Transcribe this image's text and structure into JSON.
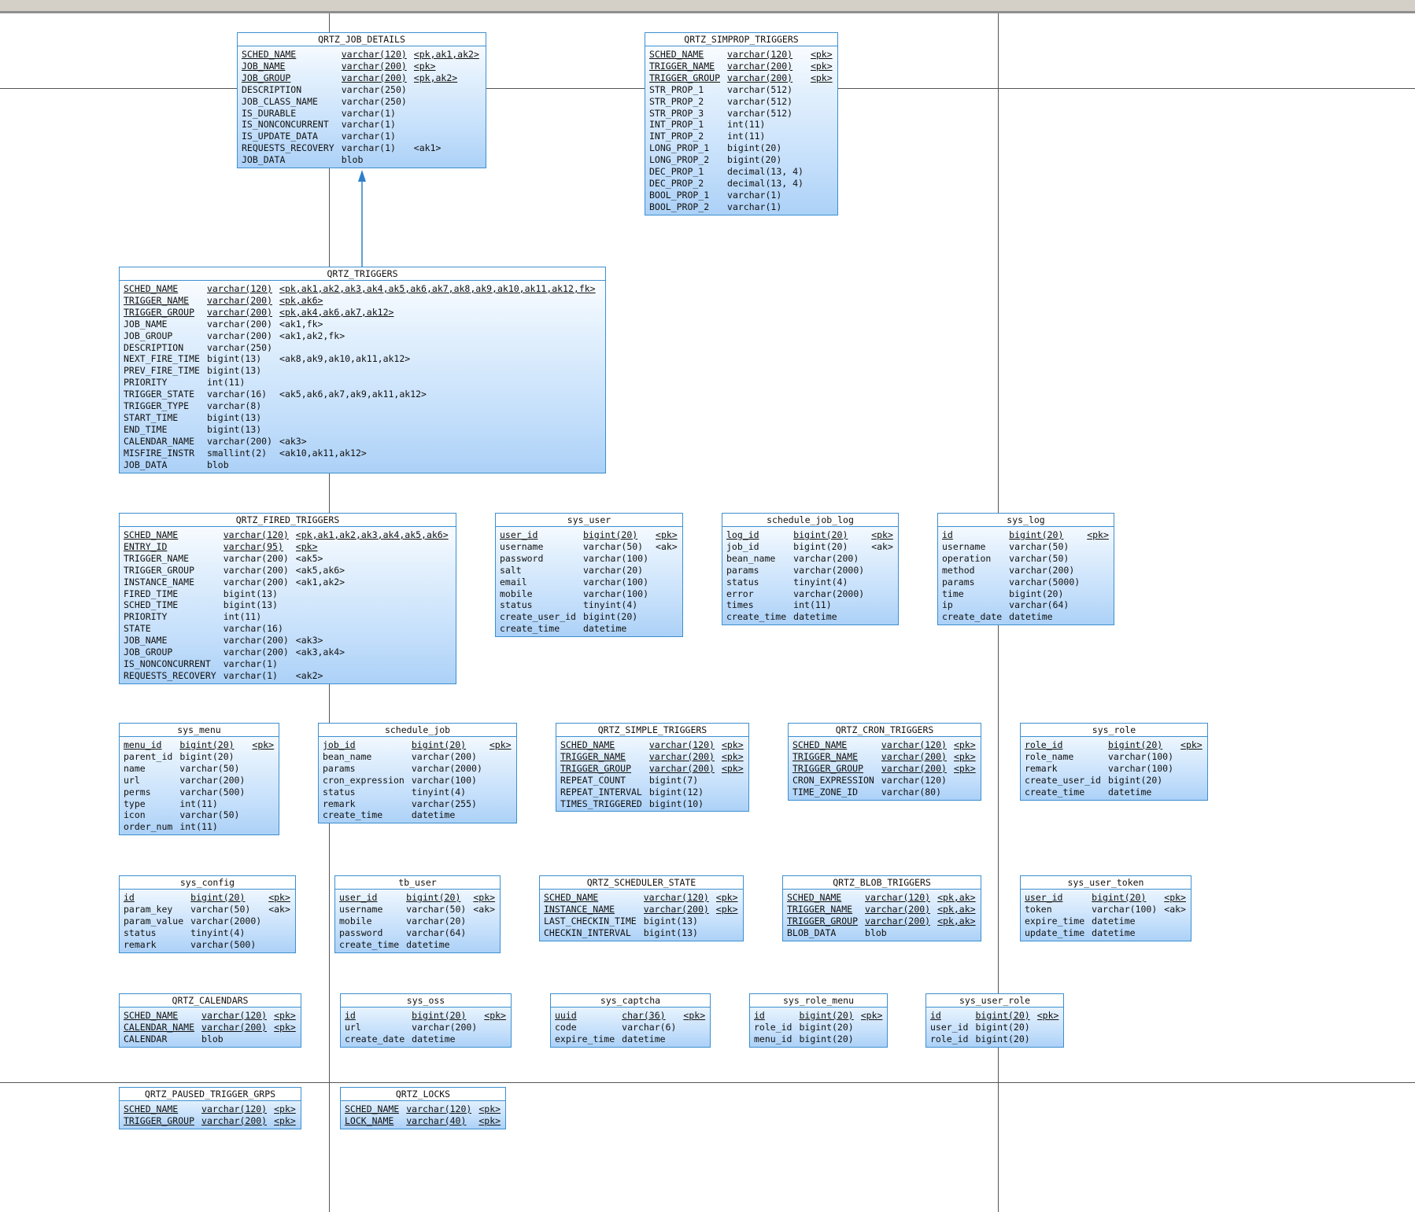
{
  "tables": [
    {
      "name": "QRTZ_JOB_DETAILS",
      "cols": [
        [
          "SCHED_NAME",
          "varchar(120)",
          "<pk,ak1,ak2>",
          1
        ],
        [
          "JOB_NAME",
          "varchar(200)",
          "<pk>",
          1
        ],
        [
          "JOB_GROUP",
          "varchar(200)",
          "<pk,ak2>",
          1
        ],
        [
          "DESCRIPTION",
          "varchar(250)",
          "",
          0
        ],
        [
          "JOB_CLASS_NAME",
          "varchar(250)",
          "",
          0
        ],
        [
          "IS_DURABLE",
          "varchar(1)",
          "",
          0
        ],
        [
          "IS_NONCONCURRENT",
          "varchar(1)",
          "",
          0
        ],
        [
          "IS_UPDATE_DATA",
          "varchar(1)",
          "",
          0
        ],
        [
          "REQUESTS_RECOVERY",
          "varchar(1)",
          "<ak1>",
          0
        ],
        [
          "JOB_DATA",
          "blob",
          "",
          0
        ]
      ]
    },
    {
      "name": "QRTZ_SIMPROP_TRIGGERS",
      "cols": [
        [
          "SCHED_NAME",
          "varchar(120)",
          "<pk>",
          1
        ],
        [
          "TRIGGER_NAME",
          "varchar(200)",
          "<pk>",
          1
        ],
        [
          "TRIGGER_GROUP",
          "varchar(200)",
          "<pk>",
          1
        ],
        [
          "STR_PROP_1",
          "varchar(512)",
          "",
          0
        ],
        [
          "STR_PROP_2",
          "varchar(512)",
          "",
          0
        ],
        [
          "STR_PROP_3",
          "varchar(512)",
          "",
          0
        ],
        [
          "INT_PROP_1",
          "int(11)",
          "",
          0
        ],
        [
          "INT_PROP_2",
          "int(11)",
          "",
          0
        ],
        [
          "LONG_PROP_1",
          "bigint(20)",
          "",
          0
        ],
        [
          "LONG_PROP_2",
          "bigint(20)",
          "",
          0
        ],
        [
          "DEC_PROP_1",
          "decimal(13, 4)",
          "",
          0
        ],
        [
          "DEC_PROP_2",
          "decimal(13, 4)",
          "",
          0
        ],
        [
          "BOOL_PROP_1",
          "varchar(1)",
          "",
          0
        ],
        [
          "BOOL_PROP_2",
          "varchar(1)",
          "",
          0
        ]
      ]
    },
    {
      "name": "QRTZ_TRIGGERS",
      "cols": [
        [
          "SCHED_NAME",
          "varchar(120)",
          "<pk,ak1,ak2,ak3,ak4,ak5,ak6,ak7,ak8,ak9,ak10,ak11,ak12,fk>",
          1
        ],
        [
          "TRIGGER_NAME",
          "varchar(200)",
          "<pk,ak6>",
          1
        ],
        [
          "TRIGGER_GROUP",
          "varchar(200)",
          "<pk,ak4,ak6,ak7,ak12>",
          1
        ],
        [
          "JOB_NAME",
          "varchar(200)",
          "<ak1,fk>",
          0
        ],
        [
          "JOB_GROUP",
          "varchar(200)",
          "<ak1,ak2,fk>",
          0
        ],
        [
          "DESCRIPTION",
          "varchar(250)",
          "",
          0
        ],
        [
          "NEXT_FIRE_TIME",
          "bigint(13)",
          "<ak8,ak9,ak10,ak11,ak12>",
          0
        ],
        [
          "PREV_FIRE_TIME",
          "bigint(13)",
          "",
          0
        ],
        [
          "PRIORITY",
          "int(11)",
          "",
          0
        ],
        [
          "TRIGGER_STATE",
          "varchar(16)",
          "<ak5,ak6,ak7,ak9,ak11,ak12>",
          0
        ],
        [
          "TRIGGER_TYPE",
          "varchar(8)",
          "",
          0
        ],
        [
          "START_TIME",
          "bigint(13)",
          "",
          0
        ],
        [
          "END_TIME",
          "bigint(13)",
          "",
          0
        ],
        [
          "CALENDAR_NAME",
          "varchar(200)",
          "<ak3>",
          0
        ],
        [
          "MISFIRE_INSTR",
          "smallint(2)",
          "<ak10,ak11,ak12>",
          0
        ],
        [
          "JOB_DATA",
          "blob",
          "",
          0
        ]
      ]
    },
    {
      "name": "QRTZ_FIRED_TRIGGERS",
      "cols": [
        [
          "SCHED_NAME",
          "varchar(120)",
          "<pk,ak1,ak2,ak3,ak4,ak5,ak6>",
          1
        ],
        [
          "ENTRY_ID",
          "varchar(95)",
          "<pk>",
          1
        ],
        [
          "TRIGGER_NAME",
          "varchar(200)",
          "<ak5>",
          0
        ],
        [
          "TRIGGER_GROUP",
          "varchar(200)",
          "<ak5,ak6>",
          0
        ],
        [
          "INSTANCE_NAME",
          "varchar(200)",
          "<ak1,ak2>",
          0
        ],
        [
          "FIRED_TIME",
          "bigint(13)",
          "",
          0
        ],
        [
          "SCHED_TIME",
          "bigint(13)",
          "",
          0
        ],
        [
          "PRIORITY",
          "int(11)",
          "",
          0
        ],
        [
          "STATE",
          "varchar(16)",
          "",
          0
        ],
        [
          "JOB_NAME",
          "varchar(200)",
          "<ak3>",
          0
        ],
        [
          "JOB_GROUP",
          "varchar(200)",
          "<ak3,ak4>",
          0
        ],
        [
          "IS_NONCONCURRENT",
          "varchar(1)",
          "",
          0
        ],
        [
          "REQUESTS_RECOVERY",
          "varchar(1)",
          "<ak2>",
          0
        ]
      ]
    },
    {
      "name": "sys_user",
      "cols": [
        [
          "user_id",
          "bigint(20)",
          "<pk>",
          1
        ],
        [
          "username",
          "varchar(50)",
          "<ak>",
          0
        ],
        [
          "password",
          "varchar(100)",
          "",
          0
        ],
        [
          "salt",
          "varchar(20)",
          "",
          0
        ],
        [
          "email",
          "varchar(100)",
          "",
          0
        ],
        [
          "mobile",
          "varchar(100)",
          "",
          0
        ],
        [
          "status",
          "tinyint(4)",
          "",
          0
        ],
        [
          "create_user_id",
          "bigint(20)",
          "",
          0
        ],
        [
          "create_time",
          "datetime",
          "",
          0
        ]
      ]
    },
    {
      "name": "schedule_job_log",
      "cols": [
        [
          "log_id",
          "bigint(20)",
          "<pk>",
          1
        ],
        [
          "job_id",
          "bigint(20)",
          "<ak>",
          0
        ],
        [
          "bean_name",
          "varchar(200)",
          "",
          0
        ],
        [
          "params",
          "varchar(2000)",
          "",
          0
        ],
        [
          "status",
          "tinyint(4)",
          "",
          0
        ],
        [
          "error",
          "varchar(2000)",
          "",
          0
        ],
        [
          "times",
          "int(11)",
          "",
          0
        ],
        [
          "create_time",
          "datetime",
          "",
          0
        ]
      ]
    },
    {
      "name": "sys_log",
      "cols": [
        [
          "id",
          "bigint(20)",
          "<pk>",
          1
        ],
        [
          "username",
          "varchar(50)",
          "",
          0
        ],
        [
          "operation",
          "varchar(50)",
          "",
          0
        ],
        [
          "method",
          "varchar(200)",
          "",
          0
        ],
        [
          "params",
          "varchar(5000)",
          "",
          0
        ],
        [
          "time",
          "bigint(20)",
          "",
          0
        ],
        [
          "ip",
          "varchar(64)",
          "",
          0
        ],
        [
          "create_date",
          "datetime",
          "",
          0
        ]
      ]
    },
    {
      "name": "sys_menu",
      "cols": [
        [
          "menu_id",
          "bigint(20)",
          "<pk>",
          1
        ],
        [
          "parent_id",
          "bigint(20)",
          "",
          0
        ],
        [
          "name",
          "varchar(50)",
          "",
          0
        ],
        [
          "url",
          "varchar(200)",
          "",
          0
        ],
        [
          "perms",
          "varchar(500)",
          "",
          0
        ],
        [
          "type",
          "int(11)",
          "",
          0
        ],
        [
          "icon",
          "varchar(50)",
          "",
          0
        ],
        [
          "order_num",
          "int(11)",
          "",
          0
        ]
      ]
    },
    {
      "name": "schedule_job",
      "cols": [
        [
          "job_id",
          "bigint(20)",
          "<pk>",
          1
        ],
        [
          "bean_name",
          "varchar(200)",
          "",
          0
        ],
        [
          "params",
          "varchar(2000)",
          "",
          0
        ],
        [
          "cron_expression",
          "varchar(100)",
          "",
          0
        ],
        [
          "status",
          "tinyint(4)",
          "",
          0
        ],
        [
          "remark",
          "varchar(255)",
          "",
          0
        ],
        [
          "create_time",
          "datetime",
          "",
          0
        ]
      ]
    },
    {
      "name": "QRTZ_SIMPLE_TRIGGERS",
      "cols": [
        [
          "SCHED_NAME",
          "varchar(120)",
          "<pk>",
          1
        ],
        [
          "TRIGGER_NAME",
          "varchar(200)",
          "<pk>",
          1
        ],
        [
          "TRIGGER_GROUP",
          "varchar(200)",
          "<pk>",
          1
        ],
        [
          "REPEAT_COUNT",
          "bigint(7)",
          "",
          0
        ],
        [
          "REPEAT_INTERVAL",
          "bigint(12)",
          "",
          0
        ],
        [
          "TIMES_TRIGGERED",
          "bigint(10)",
          "",
          0
        ]
      ]
    },
    {
      "name": "QRTZ_CRON_TRIGGERS",
      "cols": [
        [
          "SCHED_NAME",
          "varchar(120)",
          "<pk>",
          1
        ],
        [
          "TRIGGER_NAME",
          "varchar(200)",
          "<pk>",
          1
        ],
        [
          "TRIGGER_GROUP",
          "varchar(200)",
          "<pk>",
          1
        ],
        [
          "CRON_EXPRESSION",
          "varchar(120)",
          "",
          0
        ],
        [
          "TIME_ZONE_ID",
          "varchar(80)",
          "",
          0
        ]
      ]
    },
    {
      "name": "sys_role",
      "cols": [
        [
          "role_id",
          "bigint(20)",
          "<pk>",
          1
        ],
        [
          "role_name",
          "varchar(100)",
          "",
          0
        ],
        [
          "remark",
          "varchar(100)",
          "",
          0
        ],
        [
          "create_user_id",
          "bigint(20)",
          "",
          0
        ],
        [
          "create_time",
          "datetime",
          "",
          0
        ]
      ]
    },
    {
      "name": "sys_config",
      "cols": [
        [
          "id",
          "bigint(20)",
          "<pk>",
          1
        ],
        [
          "param_key",
          "varchar(50)",
          "<ak>",
          0
        ],
        [
          "param_value",
          "varchar(2000)",
          "",
          0
        ],
        [
          "status",
          "tinyint(4)",
          "",
          0
        ],
        [
          "remark",
          "varchar(500)",
          "",
          0
        ]
      ]
    },
    {
      "name": "tb_user",
      "cols": [
        [
          "user_id",
          "bigint(20)",
          "<pk>",
          1
        ],
        [
          "username",
          "varchar(50)",
          "<ak>",
          0
        ],
        [
          "mobile",
          "varchar(20)",
          "",
          0
        ],
        [
          "password",
          "varchar(64)",
          "",
          0
        ],
        [
          "create_time",
          "datetime",
          "",
          0
        ]
      ]
    },
    {
      "name": "QRTZ_SCHEDULER_STATE",
      "cols": [
        [
          "SCHED_NAME",
          "varchar(120)",
          "<pk>",
          1
        ],
        [
          "INSTANCE_NAME",
          "varchar(200)",
          "<pk>",
          1
        ],
        [
          "LAST_CHECKIN_TIME",
          "bigint(13)",
          "",
          0
        ],
        [
          "CHECKIN_INTERVAL",
          "bigint(13)",
          "",
          0
        ]
      ]
    },
    {
      "name": "QRTZ_BLOB_TRIGGERS",
      "cols": [
        [
          "SCHED_NAME",
          "varchar(120)",
          "<pk,ak>",
          1
        ],
        [
          "TRIGGER_NAME",
          "varchar(200)",
          "<pk,ak>",
          1
        ],
        [
          "TRIGGER_GROUP",
          "varchar(200)",
          "<pk,ak>",
          1
        ],
        [
          "BLOB_DATA",
          "blob",
          "",
          0
        ]
      ]
    },
    {
      "name": "sys_user_token",
      "cols": [
        [
          "user_id",
          "bigint(20)",
          "<pk>",
          1
        ],
        [
          "token",
          "varchar(100)",
          "<ak>",
          0
        ],
        [
          "expire_time",
          "datetime",
          "",
          0
        ],
        [
          "update_time",
          "datetime",
          "",
          0
        ]
      ]
    },
    {
      "name": "QRTZ_CALENDARS",
      "cols": [
        [
          "SCHED_NAME",
          "varchar(120)",
          "<pk>",
          1
        ],
        [
          "CALENDAR_NAME",
          "varchar(200)",
          "<pk>",
          1
        ],
        [
          "CALENDAR",
          "blob",
          "",
          0
        ]
      ]
    },
    {
      "name": "sys_oss",
      "cols": [
        [
          "id",
          "bigint(20)",
          "<pk>",
          1
        ],
        [
          "url",
          "varchar(200)",
          "",
          0
        ],
        [
          "create_date",
          "datetime",
          "",
          0
        ]
      ]
    },
    {
      "name": "sys_captcha",
      "cols": [
        [
          "uuid",
          "char(36)",
          "<pk>",
          1
        ],
        [
          "code",
          "varchar(6)",
          "",
          0
        ],
        [
          "expire_time",
          "datetime",
          "",
          0
        ]
      ]
    },
    {
      "name": "sys_role_menu",
      "cols": [
        [
          "id",
          "bigint(20)",
          "<pk>",
          1
        ],
        [
          "role_id",
          "bigint(20)",
          "",
          0
        ],
        [
          "menu_id",
          "bigint(20)",
          "",
          0
        ]
      ]
    },
    {
      "name": "sys_user_role",
      "cols": [
        [
          "id",
          "bigint(20)",
          "<pk>",
          1
        ],
        [
          "user_id",
          "bigint(20)",
          "",
          0
        ],
        [
          "role_id",
          "bigint(20)",
          "",
          0
        ]
      ]
    },
    {
      "name": "QRTZ_PAUSED_TRIGGER_GRPS",
      "cols": [
        [
          "SCHED_NAME",
          "varchar(120)",
          "<pk>",
          1
        ],
        [
          "TRIGGER_GROUP",
          "varchar(200)",
          "<pk>",
          1
        ]
      ]
    },
    {
      "name": "QRTZ_LOCKS",
      "cols": [
        [
          "SCHED_NAME",
          "varchar(120)",
          "<pk>",
          1
        ],
        [
          "LOCK_NAME",
          "varchar(40)",
          "<pk>",
          1
        ]
      ]
    }
  ],
  "relationships": [
    {
      "from": "QRTZ_TRIGGERS",
      "to": "QRTZ_JOB_DETAILS"
    }
  ],
  "colors": {
    "table_border": "#3c8fd0",
    "table_fill": "#c6e0fb",
    "relationship_line": "#2e7fc9",
    "page_line": "#555555"
  }
}
